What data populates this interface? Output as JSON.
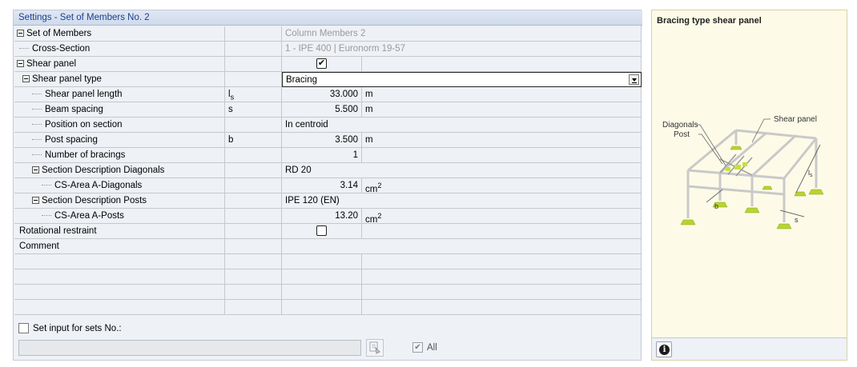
{
  "panel": {
    "title": "Settings - Set of Members No. 2"
  },
  "rows": {
    "set_of_members": {
      "name": "Set of Members",
      "value": "Column Members 2"
    },
    "cross_section": {
      "name": "Cross-Section",
      "value": "1 - IPE 400 | Euronorm 19-57"
    },
    "shear_panel": {
      "name": "Shear panel",
      "checked": true,
      "check_glyph": "✔"
    },
    "shear_panel_type": {
      "name": "Shear panel type",
      "value": "Bracing"
    },
    "shear_panel_length": {
      "name": "Shear panel length",
      "symbol": "l",
      "symbol_sub": "s",
      "value": "33.000",
      "unit": "m"
    },
    "beam_spacing": {
      "name": "Beam spacing",
      "symbol": "s",
      "value": "5.500",
      "unit": "m"
    },
    "position_on_section": {
      "name": "Position on section",
      "value": "In centroid"
    },
    "post_spacing": {
      "name": "Post spacing",
      "symbol": "b",
      "value": "3.500",
      "unit": "m"
    },
    "number_of_bracings": {
      "name": "Number of bracings",
      "value": "1"
    },
    "section_desc_diagonals": {
      "name": "Section Description Diagonals",
      "value": "RD 20"
    },
    "cs_area_diagonals": {
      "name": "CS-Area  A-Diagonals",
      "value": "3.14",
      "unit": "cm",
      "unit_sup": "2"
    },
    "section_desc_posts": {
      "name": "Section Description Posts",
      "value": "IPE 120 (EN)"
    },
    "cs_area_posts": {
      "name": "CS-Area  A-Posts",
      "value": "13.20",
      "unit": "cm",
      "unit_sup": "2"
    },
    "rotational_restraint": {
      "name": "Rotational restraint",
      "checked": false
    },
    "comment": {
      "name": "Comment",
      "value": ""
    }
  },
  "bottom": {
    "set_input_label": "Set input for sets No.:",
    "set_input_checked": false,
    "sets_value": "",
    "all_label": "All",
    "all_checked": true,
    "all_glyph": "✔"
  },
  "info_panel": {
    "title": "Bracing type shear panel",
    "info_glyph": "i",
    "diagram_labels": {
      "diagonals": "Diagonals",
      "post": "Post",
      "shear_panel": "Shear panel",
      "b": "b",
      "s": "s",
      "ls": "l",
      "ls_sub": "s"
    }
  },
  "icons": {
    "expand": "minus-box-icon",
    "dropdown": "chevron-down-icon",
    "pick": "pick-from-model-icon",
    "info": "info-icon"
  }
}
